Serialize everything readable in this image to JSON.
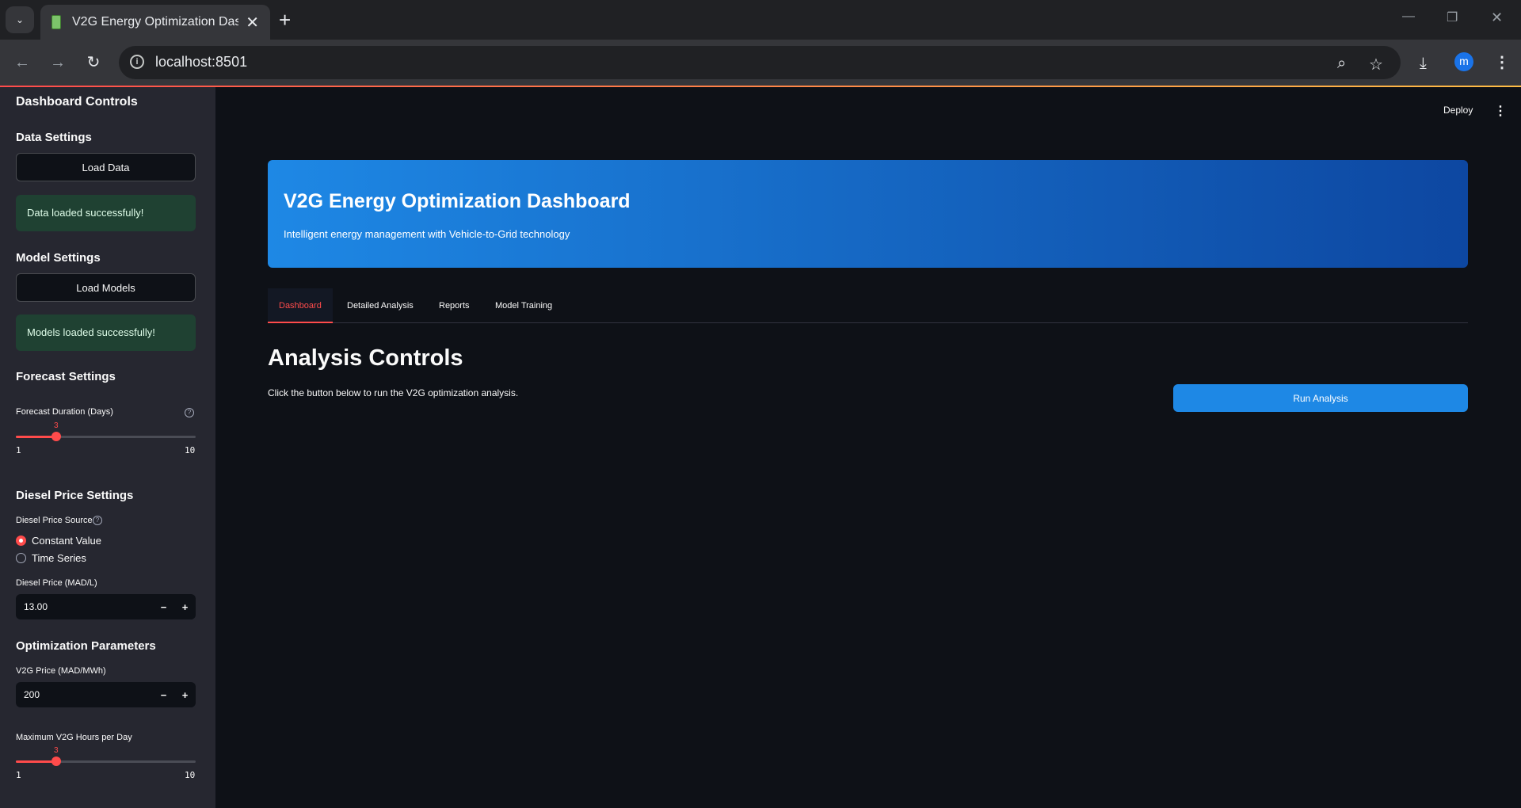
{
  "browser": {
    "tab_title": "V2G Energy Optimization Dashboard",
    "url": "localhost:8501",
    "profile_initial": "m"
  },
  "header": {
    "deploy_label": "Deploy"
  },
  "sidebar": {
    "title": "Dashboard Controls",
    "data_settings": {
      "heading": "Data Settings",
      "button_label": "Load Data",
      "status": "Data loaded successfully!"
    },
    "model_settings": {
      "heading": "Model Settings",
      "button_label": "Load Models",
      "status": "Models loaded successfully!"
    },
    "forecast_settings": {
      "heading": "Forecast Settings",
      "slider_label": "Forecast Duration (Days)",
      "value": "3",
      "min": "1",
      "max": "10"
    },
    "diesel_settings": {
      "heading": "Diesel Price Settings",
      "source_label": "Diesel Price Source",
      "options": [
        "Constant Value",
        "Time Series"
      ],
      "selected": "Constant Value",
      "price_label": "Diesel Price (MAD/L)",
      "price_value": "13.00"
    },
    "optimization": {
      "heading": "Optimization Parameters",
      "v2g_price_label": "V2G Price (MAD/MWh)",
      "v2g_price_value": "200",
      "max_hours_label": "Maximum V2G Hours per Day",
      "max_hours_value": "3",
      "min": "1",
      "max": "10"
    }
  },
  "main": {
    "banner": {
      "title": "V2G Energy Optimization Dashboard",
      "subtitle": "Intelligent energy management with Vehicle-to-Grid technology"
    },
    "tabs": [
      "Dashboard",
      "Detailed Analysis",
      "Reports",
      "Model Training"
    ],
    "active_tab": "Dashboard",
    "section_title": "Analysis Controls",
    "section_text": "Click the button below to run the V2G optimization analysis.",
    "run_button": "Run Analysis"
  },
  "colors": {
    "accent": "#ff4b4b",
    "primary_button": "#1e88e5",
    "success_bg": "#1f4132",
    "sidebar_bg": "#262730",
    "main_bg": "#0e1117"
  }
}
